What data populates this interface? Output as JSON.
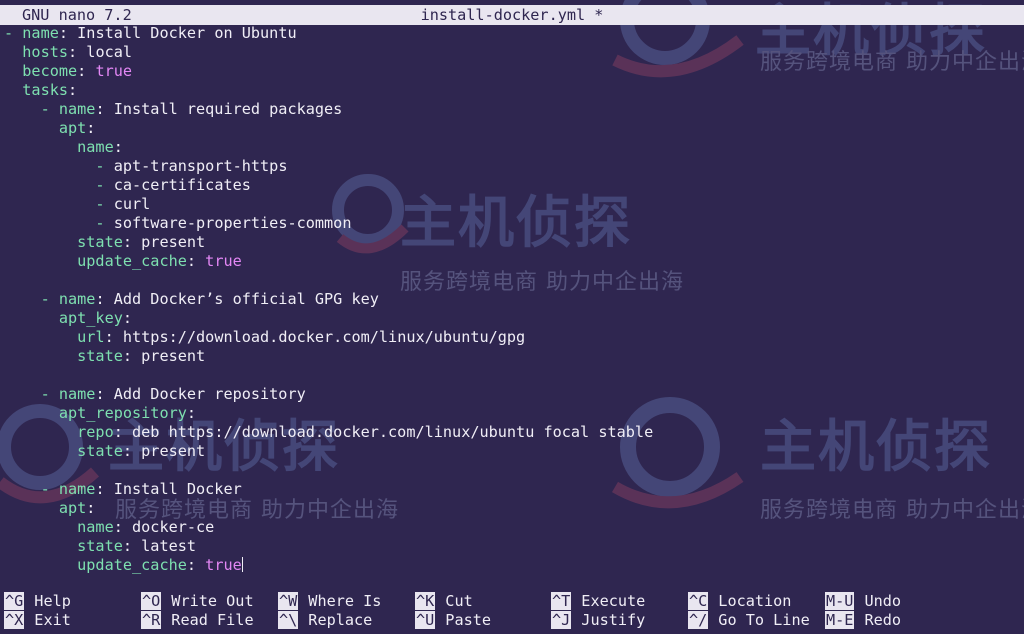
{
  "titlebar": {
    "app": "GNU nano 7.2",
    "filename": "install-docker.yml *"
  },
  "watermark": {
    "brand": "主机侦探",
    "slogan": "服务跨境电商 助力中企出海"
  },
  "colors": {
    "background": "#2f2650",
    "key": "#7ee0b0",
    "boolean": "#e387f5",
    "text": "#f0eef6"
  },
  "lines": [
    [
      [
        "k",
        "- name"
      ],
      [
        "t",
        ": Install Docker on Ubuntu"
      ]
    ],
    [
      [
        "k",
        "  hosts"
      ],
      [
        "t",
        ": local"
      ]
    ],
    [
      [
        "k",
        "  become"
      ],
      [
        "t",
        ": "
      ],
      [
        "b",
        "true"
      ]
    ],
    [
      [
        "k",
        "  tasks"
      ],
      [
        "t",
        ":"
      ]
    ],
    [
      [
        "k",
        "    - name"
      ],
      [
        "t",
        ": Install required packages"
      ]
    ],
    [
      [
        "k",
        "      apt"
      ],
      [
        "t",
        ":"
      ]
    ],
    [
      [
        "k",
        "        name"
      ],
      [
        "t",
        ":"
      ]
    ],
    [
      [
        "k",
        "          - "
      ],
      [
        "t",
        "apt-transport-https"
      ]
    ],
    [
      [
        "k",
        "          - "
      ],
      [
        "t",
        "ca-certificates"
      ]
    ],
    [
      [
        "k",
        "          - "
      ],
      [
        "t",
        "curl"
      ]
    ],
    [
      [
        "k",
        "          - "
      ],
      [
        "t",
        "software-properties-common"
      ]
    ],
    [
      [
        "k",
        "        state"
      ],
      [
        "t",
        ": present"
      ]
    ],
    [
      [
        "k",
        "        update_cache"
      ],
      [
        "t",
        ": "
      ],
      [
        "b",
        "true"
      ]
    ],
    [],
    [
      [
        "k",
        "    - name"
      ],
      [
        "t",
        ": Add Docker’s official GPG key"
      ]
    ],
    [
      [
        "k",
        "      apt_key"
      ],
      [
        "t",
        ":"
      ]
    ],
    [
      [
        "k",
        "        url"
      ],
      [
        "t",
        ": https://download.docker.com/linux/ubuntu/gpg"
      ]
    ],
    [
      [
        "k",
        "        state"
      ],
      [
        "t",
        ": present"
      ]
    ],
    [],
    [
      [
        "k",
        "    - name"
      ],
      [
        "t",
        ": Add Docker repository"
      ]
    ],
    [
      [
        "k",
        "      apt_repository"
      ],
      [
        "t",
        ":"
      ]
    ],
    [
      [
        "k",
        "        repo"
      ],
      [
        "t",
        ": deb https://download.docker.com/linux/ubuntu focal stable"
      ]
    ],
    [
      [
        "k",
        "        state"
      ],
      [
        "t",
        ": present"
      ]
    ],
    [],
    [
      [
        "k",
        "    - name"
      ],
      [
        "t",
        ": Install Docker"
      ]
    ],
    [
      [
        "k",
        "      apt"
      ],
      [
        "t",
        ":"
      ]
    ],
    [
      [
        "k",
        "        name"
      ],
      [
        "t",
        ": docker-ce"
      ]
    ],
    [
      [
        "k",
        "        state"
      ],
      [
        "t",
        ": latest"
      ]
    ],
    [
      [
        "k",
        "        update_cache"
      ],
      [
        "t",
        ": "
      ],
      [
        "b",
        "true"
      ]
    ]
  ],
  "shortcuts": {
    "help": {
      "key": "^G",
      "label": "Help"
    },
    "write_out": {
      "key": "^O",
      "label": "Write Out"
    },
    "where_is": {
      "key": "^W",
      "label": "Where Is"
    },
    "cut": {
      "key": "^K",
      "label": "Cut"
    },
    "execute": {
      "key": "^T",
      "label": "Execute"
    },
    "location": {
      "key": "^C",
      "label": "Location"
    },
    "undo": {
      "key": "M-U",
      "label": "Undo"
    },
    "exit": {
      "key": "^X",
      "label": "Exit"
    },
    "read_file": {
      "key": "^R",
      "label": "Read File"
    },
    "replace": {
      "key": "^\\",
      "label": "Replace"
    },
    "paste": {
      "key": "^U",
      "label": "Paste"
    },
    "justify": {
      "key": "^J",
      "label": "Justify"
    },
    "go_to_line": {
      "key": "^/",
      "label": "Go To Line"
    },
    "redo": {
      "key": "M-E",
      "label": "Redo"
    }
  }
}
